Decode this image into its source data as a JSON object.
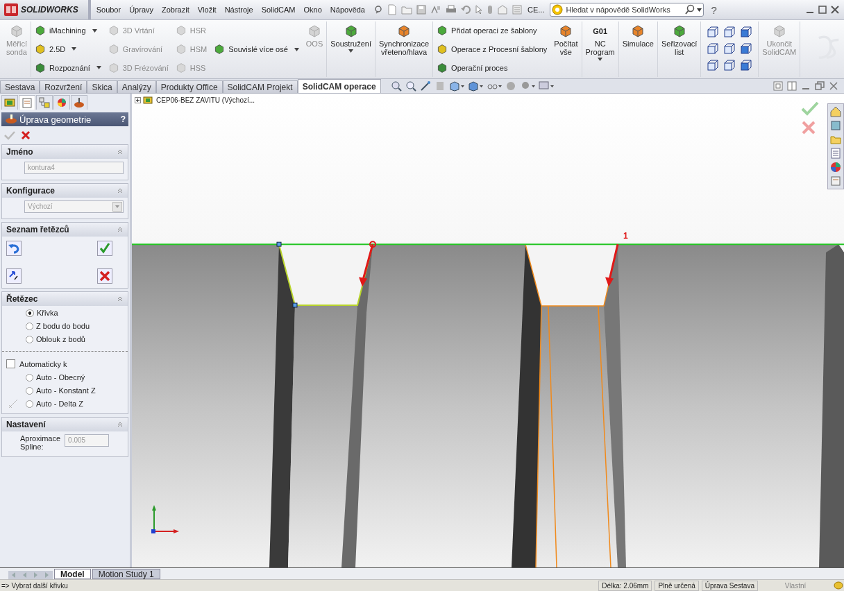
{
  "app": {
    "logo": "SOLIDWORKS"
  },
  "menu": [
    "Soubor",
    "Úpravy",
    "Zobrazit",
    "Vložit",
    "Nástroje",
    "SolidCAM",
    "Okno",
    "Nápověda"
  ],
  "quick_access": {
    "truncated_label": "CE..."
  },
  "search": {
    "placeholder": "Hledat v nápovědě SolidWorks"
  },
  "help_glyph": "?",
  "ribbon": [
    {
      "kind": "large",
      "items": [
        {
          "label": "Měřicí\nsonda",
          "disabled": true,
          "dropdown": false
        }
      ]
    },
    {
      "kind": "column",
      "items": [
        {
          "label": "iMachining",
          "disabled": false,
          "dropdown": true
        },
        {
          "label": "2.5D",
          "disabled": false,
          "dropdown": true
        },
        {
          "label": "Rozpoznání",
          "disabled": false,
          "dropdown": true
        }
      ]
    },
    {
      "kind": "column",
      "items": [
        {
          "label": "3D Vrtání",
          "disabled": true,
          "dropdown": false
        },
        {
          "label": "Gravírování",
          "disabled": true,
          "dropdown": false
        },
        {
          "label": "3D Frézování",
          "disabled": true,
          "dropdown": false
        }
      ]
    },
    {
      "kind": "column",
      "items": [
        {
          "label": "HSR",
          "disabled": true,
          "dropdown": false
        },
        {
          "label": "HSM",
          "disabled": true,
          "dropdown": false
        },
        {
          "label": "HSS",
          "disabled": true,
          "dropdown": false
        }
      ]
    },
    {
      "kind": "column",
      "items": [
        {
          "label": "Souvislé více osé",
          "disabled": false,
          "dropdown": true
        }
      ]
    },
    {
      "kind": "large",
      "items": [
        {
          "label": "OOS",
          "disabled": true,
          "dropdown": false
        }
      ]
    },
    {
      "kind": "large",
      "items": [
        {
          "label": "Soustružení",
          "disabled": false,
          "dropdown": true
        }
      ]
    },
    {
      "kind": "large",
      "items": [
        {
          "label": "Synchronizace\nvřeteno/hlava",
          "disabled": false,
          "dropdown": false
        }
      ]
    },
    {
      "kind": "column",
      "items": [
        {
          "label": "Přidat operaci ze šablony",
          "disabled": false,
          "dropdown": false
        },
        {
          "label": "Operace z Procesní šablony",
          "disabled": false,
          "dropdown": false
        },
        {
          "label": "Operační proces",
          "disabled": false,
          "dropdown": false
        }
      ]
    },
    {
      "kind": "large",
      "items": [
        {
          "label": "Počítat\nvše",
          "disabled": false,
          "dropdown": false
        }
      ]
    },
    {
      "kind": "large",
      "items": [
        {
          "label": "NC\nProgram",
          "badge": "G01",
          "disabled": false,
          "dropdown": true
        }
      ]
    },
    {
      "kind": "large",
      "items": [
        {
          "label": "Simulace",
          "disabled": false,
          "dropdown": false
        }
      ]
    },
    {
      "kind": "large",
      "items": [
        {
          "label": "Seřizovací\nlist",
          "disabled": false,
          "dropdown": false
        }
      ]
    },
    {
      "kind": "grid"
    },
    {
      "kind": "large",
      "items": [
        {
          "label": "Ukončit\nSolidCAM",
          "disabled": true,
          "dropdown": false
        }
      ]
    }
  ],
  "tabs": [
    {
      "label": "Sestava",
      "selected": false
    },
    {
      "label": "Rozvržení",
      "selected": false
    },
    {
      "label": "Skica",
      "selected": false
    },
    {
      "label": "Analýzy",
      "selected": false
    },
    {
      "label": "Produkty Office",
      "selected": false
    },
    {
      "label": "SolidCAM Projekt",
      "selected": false
    },
    {
      "label": "SolidCAM operace",
      "selected": true
    }
  ],
  "panel": {
    "title": "Úprava geometrie",
    "help": "?",
    "sections": [
      {
        "kind": "text",
        "title": "Jméno",
        "value": "kontura4"
      },
      {
        "kind": "select",
        "title": "Konfigurace",
        "value": "Výchozí"
      },
      {
        "kind": "chains",
        "title": "Seznam řetězců"
      },
      {
        "kind": "chain",
        "title": "Řetězec",
        "options": [
          {
            "label": "Křivka",
            "selected": true
          },
          {
            "label": "Z bodu do bodu",
            "selected": false
          },
          {
            "label": "Oblouk z bodů",
            "selected": false
          }
        ],
        "auto": {
          "label": "Automaticky k",
          "checked": false
        },
        "auto_options": [
          {
            "label": "Auto - Obecný",
            "selected": false
          },
          {
            "label": "Auto - Konstant Z",
            "selected": false
          },
          {
            "label": "Auto - Delta Z",
            "selected": false
          }
        ]
      },
      {
        "kind": "settings",
        "title": "Nastavení",
        "label": "Aproximace\nSpline:",
        "value": "0.005"
      }
    ]
  },
  "viewport": {
    "tree_item": "CEP06-BEZ ZAVITU (Výchozí...",
    "point_label": "1"
  },
  "bottom_tabs": [
    {
      "label": "Model",
      "selected": true
    },
    {
      "label": "Motion Study 1",
      "selected": false
    }
  ],
  "status_bar": {
    "prompt": "=> Vybrat další křivku",
    "length": "Délka: 2.06mm",
    "state": "Plně určená",
    "mode": "Úprava Sestava",
    "units": "Vlastní"
  }
}
